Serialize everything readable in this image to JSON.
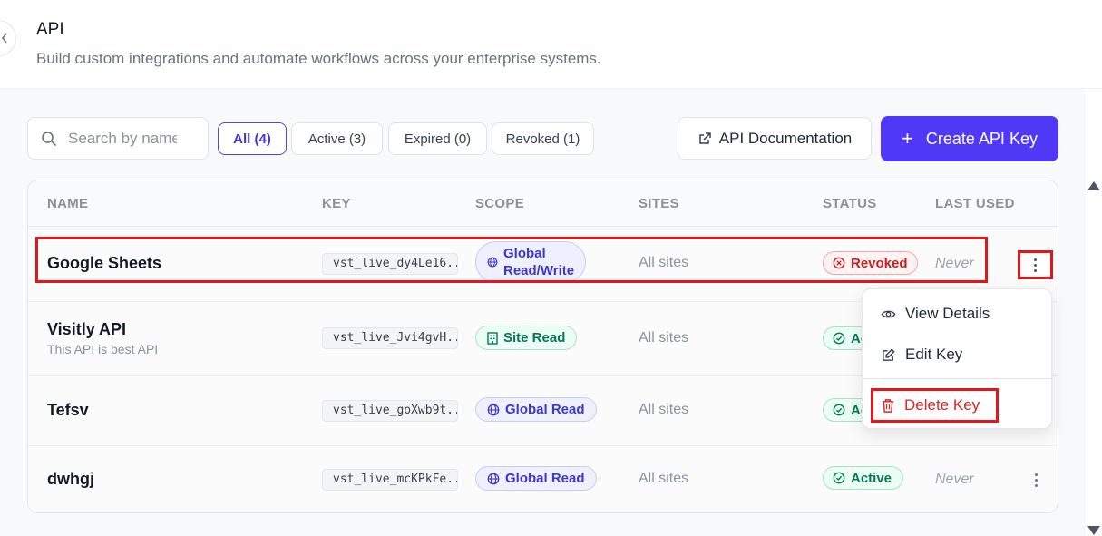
{
  "header": {
    "back_icon": "chevron-left-icon",
    "title": "API",
    "subtitle": "Build custom integrations and automate workflows across your enterprise systems."
  },
  "toolbar": {
    "search_placeholder": "Search by name",
    "search_icon": "search-icon",
    "filters": [
      {
        "label": "All (4)",
        "selected": true
      },
      {
        "label": "Active (3)",
        "selected": false
      },
      {
        "label": "Expired (0)",
        "selected": false
      },
      {
        "label": "Revoked (1)",
        "selected": false
      }
    ],
    "doc_button": "API Documentation",
    "doc_icon": "external-link-icon",
    "create_button": "Create API Key",
    "create_icon": "plus-icon"
  },
  "table": {
    "columns": [
      "NAME",
      "KEY",
      "SCOPE",
      "SITES",
      "STATUS",
      "LAST USED"
    ],
    "rows": [
      {
        "name": "Google Sheets",
        "description": "",
        "key": "vst_live_dy4Le16...",
        "scope_line1": "Global",
        "scope_line2": "Read/Write",
        "scope_type": "global",
        "sites": "All sites",
        "status": "Revoked",
        "last_used": "Never"
      },
      {
        "name": "Visitly API",
        "description": "This API is best API",
        "key": "vst_live_Jvi4gvH...",
        "scope": "Site Read",
        "scope_type": "site",
        "sites": "All sites",
        "status": "Active",
        "last_used": ""
      },
      {
        "name": "Tefsv",
        "description": "",
        "key": "vst_live_goXwb9t...",
        "scope": "Global Read",
        "scope_type": "global",
        "sites": "All sites",
        "status": "Active",
        "last_used": ""
      },
      {
        "name": "dwhgj",
        "description": "",
        "key": "vst_live_mcKPkFe...",
        "scope": "Global Read",
        "scope_type": "global",
        "sites": "All sites",
        "status": "Active",
        "last_used": "Never"
      }
    ]
  },
  "row_menu": {
    "items": [
      {
        "label": "View Details",
        "icon": "eye-icon"
      },
      {
        "label": "Edit Key",
        "icon": "edit-icon"
      },
      {
        "label": "Delete Key",
        "icon": "trash-icon"
      }
    ]
  },
  "colors": {
    "primary": "#4f38f6",
    "highlight": "#e3161c",
    "revoked": "#c81e1e",
    "active": "#047857",
    "scope_global": "#3f37c9"
  }
}
